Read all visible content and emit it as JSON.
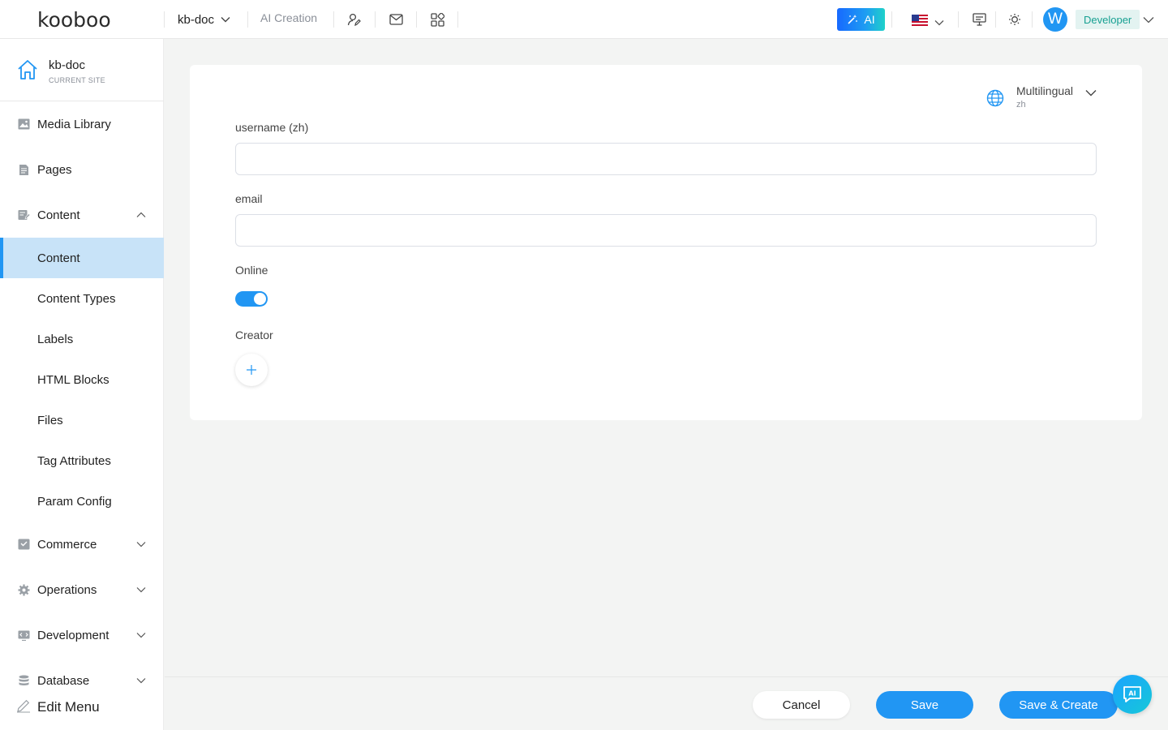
{
  "header": {
    "logo": "kooboo",
    "site_name": "kb-doc",
    "ai_creation": "AI Creation",
    "ai_button": "AI",
    "language_flag": "us-flag-icon",
    "avatar_letter": "W",
    "role": "Developer"
  },
  "sidebar": {
    "current_site": {
      "name": "kb-doc",
      "subtitle": "CURRENT SITE"
    },
    "items": [
      {
        "label": "Media Library",
        "icon": "image-icon"
      },
      {
        "label": "Pages",
        "icon": "page-icon"
      },
      {
        "label": "Content",
        "icon": "content-icon",
        "expanded": true
      },
      {
        "label": "Content",
        "active": true
      },
      {
        "label": "Content Types"
      },
      {
        "label": "Labels"
      },
      {
        "label": "HTML Blocks"
      },
      {
        "label": "Files"
      },
      {
        "label": "Tag Attributes"
      },
      {
        "label": "Param Config"
      },
      {
        "label": "Commerce",
        "icon": "commerce-icon"
      },
      {
        "label": "Operations",
        "icon": "gear-icon"
      },
      {
        "label": "Development",
        "icon": "code-icon"
      },
      {
        "label": "Database",
        "icon": "database-icon"
      }
    ],
    "edit_menu": "Edit Menu"
  },
  "form": {
    "multilingual": {
      "title": "Multilingual",
      "code": "zh"
    },
    "fields": {
      "username": {
        "label": "username (zh)",
        "value": ""
      },
      "email": {
        "label": "email",
        "value": ""
      },
      "online": {
        "label": "Online",
        "checked": true
      },
      "creator": {
        "label": "Creator"
      }
    }
  },
  "footer": {
    "cancel": "Cancel",
    "save": "Save",
    "save_create": "Save & Create"
  },
  "colors": {
    "primary": "#2196f3",
    "active_nav_bg": "#c8e3f8",
    "role_badge_bg": "#e3f3f1",
    "role_badge_text": "#17a092"
  }
}
